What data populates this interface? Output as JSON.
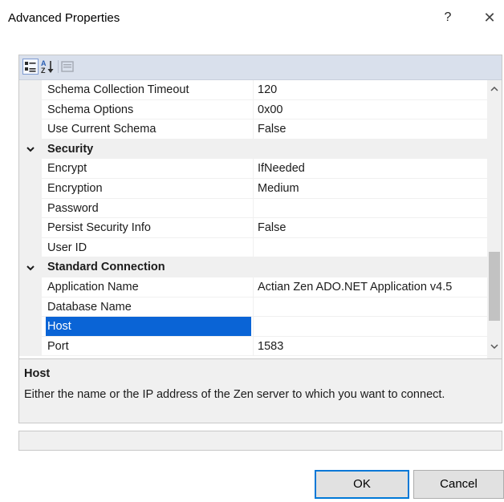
{
  "window": {
    "title": "Advanced Properties",
    "help_glyph": "?",
    "close_glyph": "✕"
  },
  "toolbar": {
    "buttons": [
      "categorized-icon",
      "alphabetical-icon",
      "property-pages-icon"
    ]
  },
  "grid": {
    "rows": [
      {
        "kind": "prop",
        "name": "Schema Collection Timeout",
        "value": "120"
      },
      {
        "kind": "prop",
        "name": "Schema Options",
        "value": "0x00"
      },
      {
        "kind": "prop",
        "name": "Use Current Schema",
        "value": "False"
      },
      {
        "kind": "category",
        "name": "Security",
        "value": ""
      },
      {
        "kind": "prop",
        "name": "Encrypt",
        "value": "IfNeeded"
      },
      {
        "kind": "prop",
        "name": "Encryption",
        "value": "Medium"
      },
      {
        "kind": "prop",
        "name": "Password",
        "value": ""
      },
      {
        "kind": "prop",
        "name": "Persist Security Info",
        "value": "False"
      },
      {
        "kind": "prop",
        "name": "User ID",
        "value": ""
      },
      {
        "kind": "category",
        "name": "Standard Connection",
        "value": ""
      },
      {
        "kind": "prop",
        "name": "Application Name",
        "value": "Actian Zen ADO.NET Application v4.5"
      },
      {
        "kind": "prop",
        "name": "Database Name",
        "value": ""
      },
      {
        "kind": "prop",
        "name": "Host",
        "value": "",
        "selected": true
      },
      {
        "kind": "prop",
        "name": "Port",
        "value": "1583"
      }
    ],
    "scrollbar": {
      "up_glyph": "︿",
      "down_glyph": "﹀"
    }
  },
  "description": {
    "title": "Host",
    "text": "Either the name or the IP address of the Zen server to which you want to connect."
  },
  "buttons": {
    "ok": "OK",
    "cancel": "Cancel"
  },
  "colors": {
    "selection": "#0a64d6",
    "toolbar": "#d9e0ec",
    "ok_border": "#0078d7"
  }
}
